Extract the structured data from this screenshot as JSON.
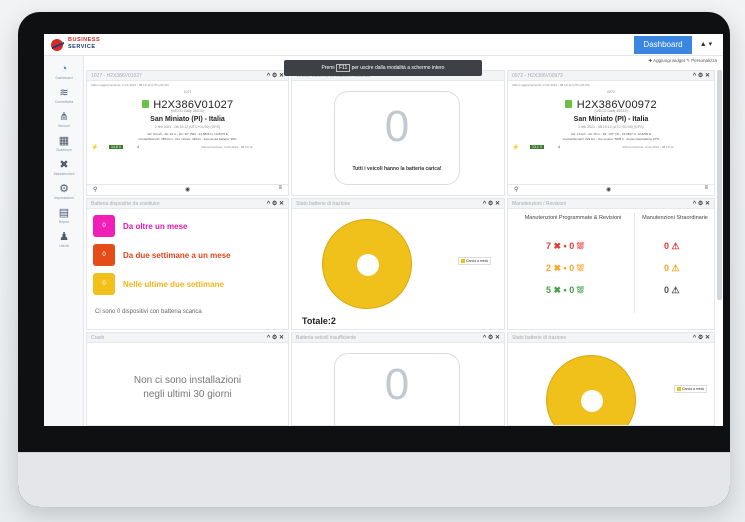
{
  "topbar": {
    "brand_line1": "BUSINESS",
    "brand_line2": "SERVICE",
    "dashboard_label": "Dashboard",
    "user_label": "▲ ▾"
  },
  "subbar": {
    "actions": "✚ Aggiungi widget  ✎ Personalizza"
  },
  "sidebar": {
    "items": [
      {
        "icon": "speedometer-icon",
        "glyph": "◔",
        "label": "Dashboard"
      },
      {
        "icon": "wifi-icon",
        "glyph": "≋",
        "label": "Connettività"
      },
      {
        "icon": "antenna-icon",
        "glyph": "⋔",
        "label": "Sensori"
      },
      {
        "icon": "calendar-icon",
        "glyph": "▦",
        "label": "Scadenze"
      },
      {
        "icon": "tools-icon",
        "glyph": "✖",
        "label": "Manutenzioni"
      },
      {
        "icon": "gears-icon",
        "glyph": "⚙",
        "label": "Impostazioni"
      },
      {
        "icon": "document-icon",
        "glyph": "▤",
        "label": "Report"
      },
      {
        "icon": "users-icon",
        "glyph": "♟",
        "label": "Utenti"
      }
    ]
  },
  "tooltip": {
    "prefix": "Premi",
    "key": "F11",
    "suffix": "per uscire dalla modalità a schermo intero"
  },
  "panels": {
    "vehicle1": {
      "title": "1027 - H2X386V01027",
      "ctl": "^ ⚙ ✕",
      "top_small": "Ultimo aggiornamento: 2 feb 2021 - 08:10:12 (UTC+01:00)",
      "code": "1027",
      "vid": "H2X386V01027",
      "model": "(IVECO Daily 35S13)",
      "location": "San Miniato (PI) - Italia",
      "date_small": "2 feb 2021 - 08:10:12 (UTC+01:00) (GPS)",
      "line1": "Vel: 0 km/h - Alt: 23 m - Dir: 30° (NE) - 43.6836 N, 10.8479 E",
      "line2": "Contachilometri: 7854 km - Ore motore: 4364 h - Autonomia batteria: 98%",
      "line3": "Ultima ricezione: 2 feb 2021 - 08:10:12",
      "badge1": "14,8 V",
      "badge2": "4",
      "zoom": "🔍",
      "eye": "👁",
      "menu": "≡"
    },
    "allcharged": {
      "title": "Veicoli batteria di trazione scarica",
      "zero": "0",
      "message": "Tutti i veicoli hanno la batteria carica!"
    },
    "vehicle2": {
      "title": "0972 - H2X386V00972",
      "ctl": "^ ⚙ ✕",
      "top_small": "Ultimo aggiornamento: 2 feb 2021 - 08:10:12 (UTC+01:00)",
      "code": "0972",
      "vid": "H2X386V00972",
      "model": "(IVECO Daily 35S13)",
      "location": "San Miniato (PI) - Italia",
      "date_small": "2 feb 2021 - 08:10:12 (UTC+01:00) (GPS)",
      "line1": "Vel: 0 km/h - Alt: 15 m - Dir: 170° (S) - 43.6837 N, 10.8299 E",
      "line2": "Contachilometri: 629 km - Ore motore: 5895 h - Autonomia batteria: 87%",
      "line3": "Ultima ricezione: 2 feb 2021 - 08:10:12",
      "badge1": "13,1 V",
      "badge2": "4",
      "zoom": "🔍",
      "eye": "👁",
      "menu": "≡"
    },
    "battery_devices": {
      "title": "Batteria dispositivi da sostituire",
      "ctl": "^ ⚙ ✕",
      "rows": [
        {
          "count": "0",
          "label": "Da oltre un mese",
          "color": "#f01fb8",
          "text_color": "#e21aa8"
        },
        {
          "count": "0",
          "label": "Da due settimane a un mese",
          "color": "#e44d1a",
          "text_color": "#e0461a"
        },
        {
          "count": "0",
          "label": "Nelle ultime due settimane",
          "color": "#f3bf1a",
          "text_color": "#f0b51a"
        }
      ],
      "note": "Ci sono 0 dispositivi con batteria scarica"
    },
    "traction_state": {
      "title": "Stato batterie di trazione",
      "ctl": "^ ⚙ ✕",
      "legend": "Carica a metà",
      "total": "Totale:2"
    },
    "maintenance": {
      "title": "Manutenzioni / Revisioni",
      "ctl": "^ ⚙ ✕",
      "col1_head": "Manutenzioni Programmate & Revisioni",
      "col2_head": "Manutenzioni Straordinarie",
      "rows": [
        {
          "prog": "7 ✖ • 0 ⛆",
          "stra": "0 ⚠",
          "color": "#e53935"
        },
        {
          "prog": "2 ✖ • 0 ⛆",
          "stra": "0 ⚠",
          "color": "#f5a623"
        },
        {
          "prog": "5 ✖ • 0 ⛆",
          "stra": "0 ⚠",
          "color": "#43a047"
        }
      ]
    },
    "crashes": {
      "title": "Crash",
      "ctl": "^ ⚙ ✕",
      "message_line1": "Non ci sono installazioni",
      "message_line2": "negli ultimi 30 giorni"
    },
    "insufficient": {
      "title": "Batteria veicoli insufficiente",
      "ctl": "^ ⚙ ✕",
      "zero": "0"
    },
    "traction_state2": {
      "title": "Stato batterie di trazione",
      "ctl": "^ ⚙ ✕",
      "legend": "Carica a metà"
    }
  },
  "colors": {
    "accent": "#3a86e0",
    "donut": "#f0c11b",
    "vehicle_icon": "#6abf45"
  }
}
